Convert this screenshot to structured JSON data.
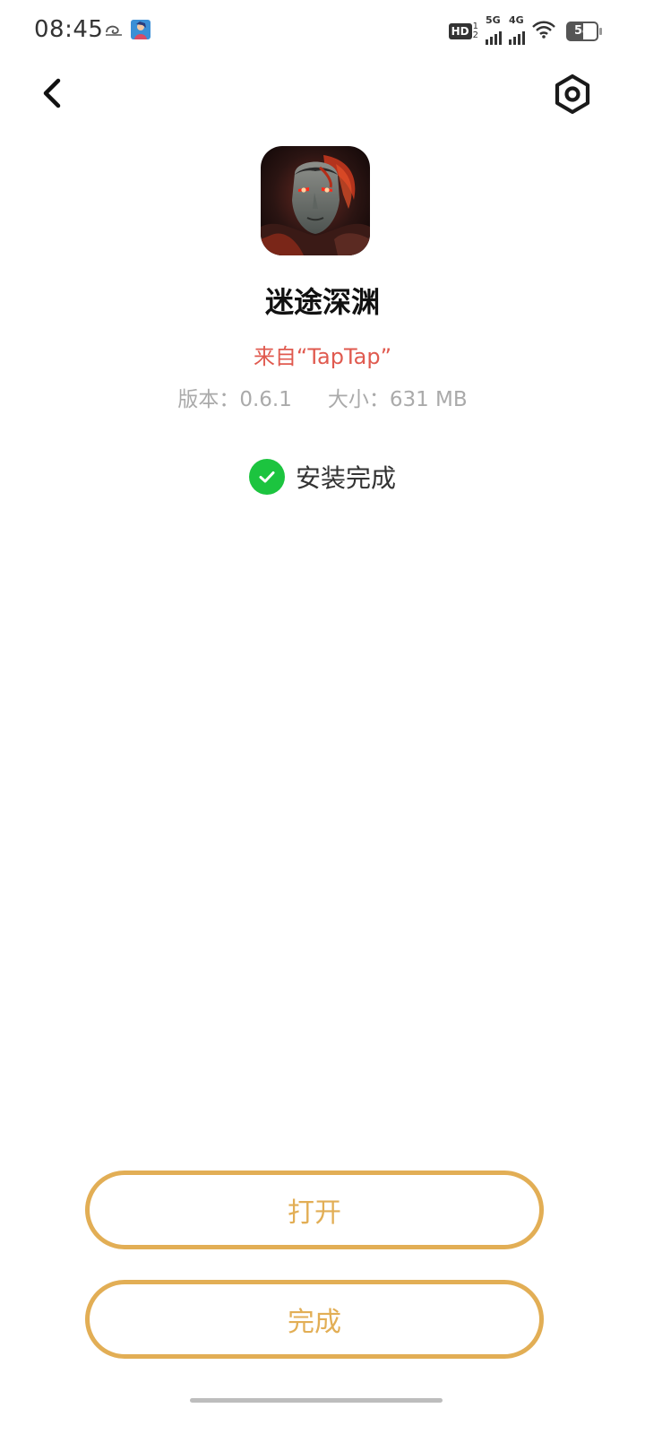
{
  "status_bar": {
    "time": "08:45",
    "hd_label": "HD",
    "hd_sub_top": "1",
    "hd_sub_bottom": "2",
    "signal1_label": "5G",
    "signal2_label": "4G",
    "battery_percent": "54",
    "battery_level": 0.54
  },
  "header": {
    "back_icon": "chevron-left-icon",
    "settings_icon": "settings-hexagon-icon"
  },
  "app": {
    "name": "迷途深渊",
    "source": "来自“TapTap”",
    "version": "版本：0.6.1",
    "size": "大小：631 MB"
  },
  "install": {
    "status": "安装完成",
    "status_color": "#1cc43f"
  },
  "buttons": {
    "open_label": "打开",
    "done_label": "完成",
    "accent_color": "#e2ae55"
  }
}
